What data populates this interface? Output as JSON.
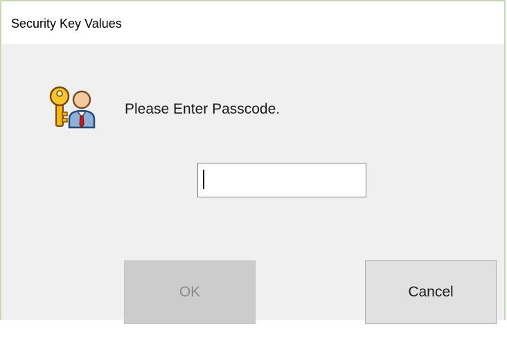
{
  "window": {
    "title": "Security Key Values"
  },
  "dialog": {
    "icon": "key-user-icon",
    "prompt": "Please Enter Passcode.",
    "passcode": {
      "value": "",
      "placeholder": ""
    },
    "buttons": {
      "ok_label": "OK",
      "ok_enabled": false,
      "cancel_label": "Cancel"
    }
  },
  "colors": {
    "client_background": "#f0f0f0",
    "titlebar_background": "#ffffff",
    "window_border": "#c8d8b4",
    "ok_disabled_background": "#cccccc",
    "ok_disabled_text": "#8a8a8a",
    "cancel_background": "#e1e1e1"
  }
}
